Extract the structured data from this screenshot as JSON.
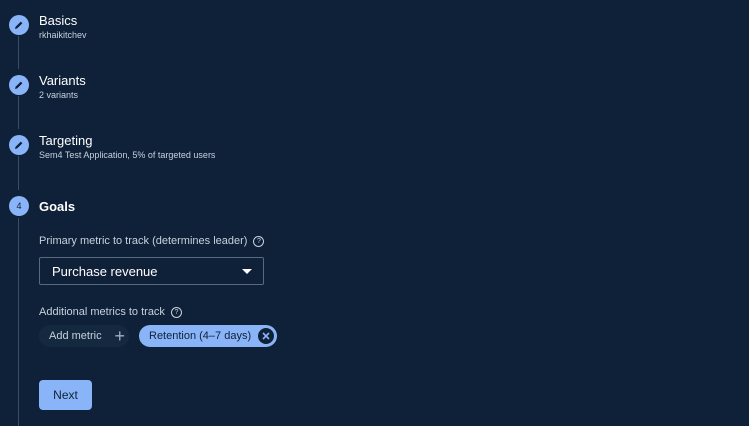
{
  "steps": [
    {
      "title": "Basics",
      "subtitle": "rkhaikitchev"
    },
    {
      "title": "Variants",
      "subtitle": "2 variants"
    },
    {
      "title": "Targeting",
      "subtitle": "Sem4 Test Application, 5% of targeted users"
    },
    {
      "number": "4",
      "title": "Goals"
    }
  ],
  "goals": {
    "primary_label": "Primary metric to track (determines leader)",
    "primary_value": "Purchase revenue",
    "additional_label": "Additional metrics to track",
    "add_metric_label": "Add metric",
    "selected_metrics": [
      "Retention (4–7 days)"
    ]
  },
  "next_label": "Next",
  "colors": {
    "background": "#0f2138",
    "accent": "#8ab4f8",
    "rail": "#3b4d63"
  },
  "icons": {
    "completed_step": "pencil-icon",
    "help": "help-icon",
    "add": "plus-icon",
    "remove": "close-icon",
    "dropdown": "caret-down-icon"
  }
}
